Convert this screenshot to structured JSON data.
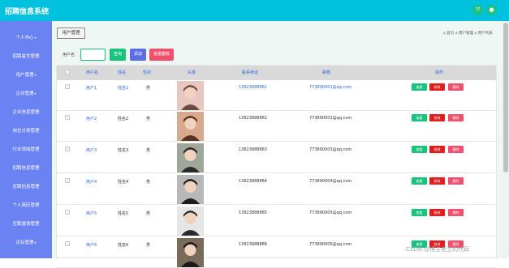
{
  "app": {
    "title": "招聘信息系统"
  },
  "topbar": {
    "icons": [
      "expand-icon",
      "user-icon"
    ]
  },
  "sidebar": {
    "items": [
      {
        "label": "个人中心",
        "has_arrow": true
      },
      {
        "label": "招聘留言管理",
        "has_arrow": false
      },
      {
        "label": "用户管理",
        "has_arrow": true
      },
      {
        "label": "企业管理",
        "has_arrow": true
      },
      {
        "label": "企业信息管理",
        "has_arrow": false
      },
      {
        "label": "岗位分类管理",
        "has_arrow": false
      },
      {
        "label": "行业领域管理",
        "has_arrow": false
      },
      {
        "label": "招聘信息管理",
        "has_arrow": false
      },
      {
        "label": "应聘信息管理",
        "has_arrow": false
      },
      {
        "label": "个人简历管理",
        "has_arrow": false
      },
      {
        "label": "应聘邀请管理",
        "has_arrow": false
      },
      {
        "label": "论坛管理",
        "has_arrow": true
      }
    ]
  },
  "page": {
    "button_label": "用户管理",
    "breadcrumb_home": "首页",
    "breadcrumb_sep1": "用户管理",
    "breadcrumb_sep2": "用户列表"
  },
  "search": {
    "label": "用户名",
    "value": "",
    "query_label": "查询",
    "add_label": "添加",
    "batch_delete_label": "批量删除"
  },
  "table": {
    "headers": [
      "用户名",
      "姓名",
      "性别",
      "头像",
      "联系电话",
      "邮箱",
      "操作"
    ],
    "rows": [
      {
        "username": "用户1",
        "name": "姓名1",
        "gender": "男",
        "phone": "13823888881",
        "email": "773890001@qq.com"
      },
      {
        "username": "用户2",
        "name": "姓名2",
        "gender": "男",
        "phone": "13823888882",
        "email": "773890002@qq.com"
      },
      {
        "username": "用户3",
        "name": "姓名3",
        "gender": "男",
        "phone": "13823888883",
        "email": "773890003@qq.com"
      },
      {
        "username": "用户4",
        "name": "姓名4",
        "gender": "男",
        "phone": "13823888884",
        "email": "773890004@qq.com"
      },
      {
        "username": "用户5",
        "name": "姓名5",
        "gender": "男",
        "phone": "13823888885",
        "email": "773890005@qq.com"
      },
      {
        "username": "用户6",
        "name": "姓名6",
        "gender": "男",
        "phone": "13823888886",
        "email": "773890006@qq.com"
      }
    ],
    "actions": {
      "view": "查看",
      "edit": "修改",
      "delete": "删除"
    }
  },
  "watermark": "CSDN @博主老王的代码",
  "colors": {
    "topbar": "#00c1de",
    "sidebar": "#6a82f2",
    "content_bg": "#eef7f4",
    "view_btn": "#19c37d",
    "add_btn": "#5b6ee8",
    "edit_btn": "#e11d1d",
    "delete_btn": "#f0506e",
    "header_text": "#2f6ae0"
  }
}
